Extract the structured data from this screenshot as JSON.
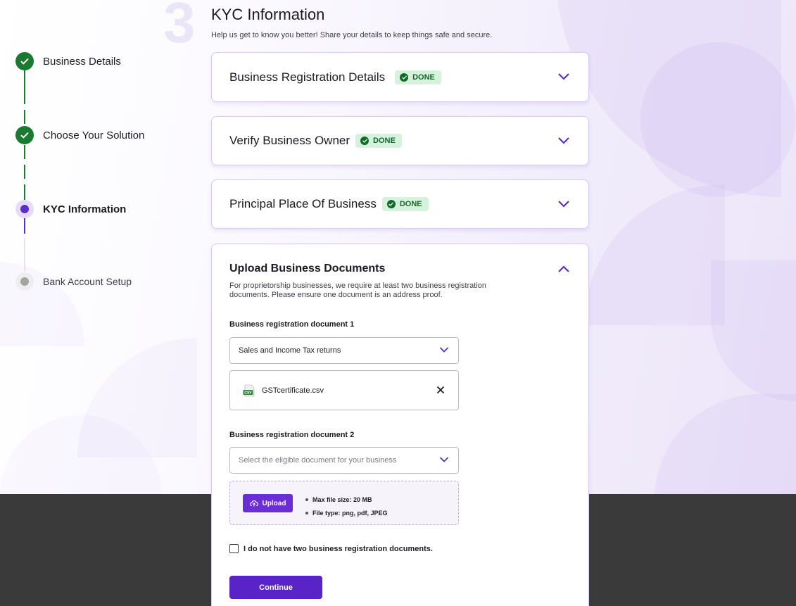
{
  "page": {
    "step_number": "3",
    "title": "KYC Information",
    "subtitle": "Help us get to know you better! Share your details to keep things safe and secure."
  },
  "stepper": [
    {
      "label": "Business Details",
      "status": "done"
    },
    {
      "label": "Choose Your Solution",
      "status": "done"
    },
    {
      "label": "KYC Information",
      "status": "active"
    },
    {
      "label": "Bank Account Setup",
      "status": "pending"
    }
  ],
  "sections": [
    {
      "title": "Business Registration Details",
      "badge": "DONE"
    },
    {
      "title": "Verify Business Owner",
      "badge": "DONE"
    },
    {
      "title": "Principal Place Of Business",
      "badge": "DONE"
    }
  ],
  "upload": {
    "title": "Upload Business Documents",
    "description": "For proprietorship businesses, we require at least two business registration documents. Please ensure one document is an address proof.",
    "doc1_label": "Business registration document 1",
    "doc1_value": "Sales and Income Tax returns",
    "file_name": "GSTcertificate.csv",
    "file_icon_text": "CSV",
    "doc2_label": "Business registration document 2",
    "doc2_placeholder": "Select the eligible document for your business",
    "upload_button": "Upload",
    "rule_size": "Max file size: 20 MB",
    "rule_type": "File type: png, pdf, JPEG",
    "checkbox_label": "I do not have two business registration documents.",
    "continue_button": "Continue"
  },
  "colors": {
    "primary": "#5a23c8",
    "done_green": "#1a7a2f",
    "badge_bg": "#d7f2dc",
    "footer_dark": "#3a3a3a"
  },
  "icons": {
    "done": "check-circle-icon",
    "expand": "chevron-down-icon",
    "collapse": "chevron-up-icon",
    "upload": "cloud-upload-icon",
    "file": "csv-file-icon",
    "remove": "close-icon"
  }
}
